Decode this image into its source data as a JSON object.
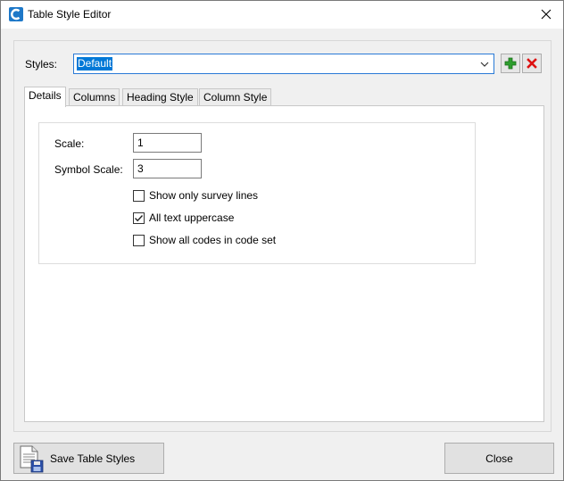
{
  "window": {
    "title": "Table Style Editor",
    "accent": "#0078d7"
  },
  "styles": {
    "label": "Styles:",
    "value": "Default",
    "add_icon": "plus-icon",
    "delete_icon": "delete-x-icon"
  },
  "tabs": [
    {
      "label": "Details",
      "active": true
    },
    {
      "label": "Columns",
      "active": false
    },
    {
      "label": "Heading Style",
      "active": false
    },
    {
      "label": "Column Style",
      "active": false
    }
  ],
  "details": {
    "scale_label": "Scale:",
    "scale_value": "1",
    "symbol_scale_label": "Symbol Scale:",
    "symbol_scale_value": "3",
    "options": [
      {
        "label": "Show only survey lines",
        "checked": false
      },
      {
        "label": "All text uppercase",
        "checked": true
      },
      {
        "label": "Show all codes in code set",
        "checked": false
      }
    ]
  },
  "footer": {
    "save_label": "Save Table Styles",
    "close_label": "Close"
  }
}
